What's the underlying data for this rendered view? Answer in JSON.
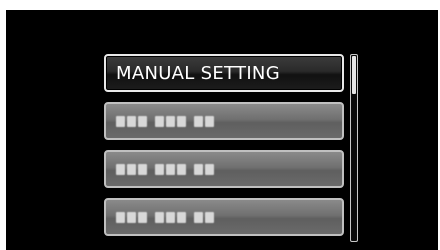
{
  "menu": {
    "items": [
      {
        "label": "MANUAL SETTING",
        "selected": true
      },
      {
        "label": "",
        "selected": false
      },
      {
        "label": "",
        "selected": false
      },
      {
        "label": "",
        "selected": false
      }
    ]
  },
  "scrollbar": {
    "position_fraction": 0.0
  },
  "colors": {
    "background": "#000000",
    "selected_item": "#1e1e1e",
    "unselected_item": "#6e6e6e",
    "text": "#ffffff"
  }
}
